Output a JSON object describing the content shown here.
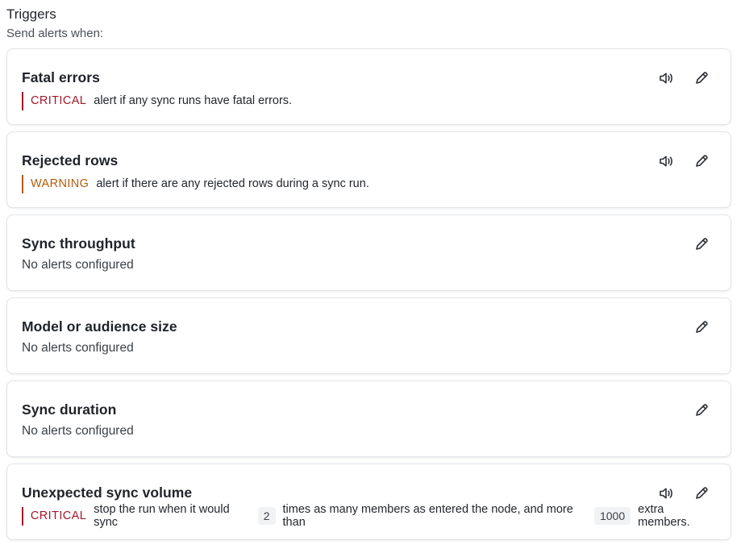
{
  "header": {
    "title": "Triggers",
    "subtitle": "Send alerts when:"
  },
  "colors": {
    "critical": "#a2172a",
    "warning": "#b35c0a",
    "border": "#e2e4e8"
  },
  "icons": {
    "mute": "speaker-icon",
    "edit": "pencil-icon"
  },
  "triggers": [
    {
      "title": "Fatal errors",
      "severity": "CRITICAL",
      "description": "alert if any sync runs have fatal errors.",
      "has_mute": true
    },
    {
      "title": "Rejected rows",
      "severity": "WARNING",
      "description": "alert if there are any rejected rows during a sync run.",
      "has_mute": true
    },
    {
      "title": "Sync throughput",
      "empty_text": "No alerts configured",
      "has_mute": false
    },
    {
      "title": "Model or audience size",
      "empty_text": "No alerts configured",
      "has_mute": false
    },
    {
      "title": "Sync duration",
      "empty_text": "No alerts configured",
      "has_mute": false
    },
    {
      "title": "Unexpected sync volume",
      "severity": "CRITICAL",
      "description_parts": {
        "part1": "stop the run when it would sync",
        "multiplier": "2",
        "part2": "times as many members as entered the node, and more than",
        "threshold": "1000",
        "part3": "extra members."
      },
      "has_mute": true
    }
  ]
}
